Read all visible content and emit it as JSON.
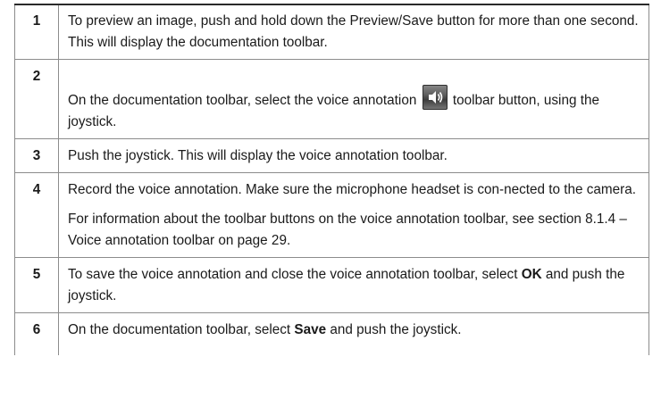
{
  "steps": [
    {
      "number": "1",
      "text": "To preview an image, push and hold down the Preview/Save button for more than one second. This will display the documentation toolbar."
    },
    {
      "number": "2",
      "text_before": "On the documentation toolbar, select the voice annotation ",
      "icon": "voice-annotation-speaker-icon",
      "text_after": " toolbar button, using the joystick."
    },
    {
      "number": "3",
      "text": "Push the joystick. This will display the voice annotation toolbar."
    },
    {
      "number": "4",
      "text": "Record the voice annotation. Make sure the microphone headset is con-nected to the camera.",
      "text2": "For information about the toolbar buttons on the voice annotation toolbar, see section 8.1.4 – Voice annotation toolbar on page 29."
    },
    {
      "number": "5",
      "text_before": "To save the voice annotation and close the voice annotation toolbar, select ",
      "bold": "OK",
      "text_after": " and push the joystick."
    },
    {
      "number": "6",
      "text_before": "On the documentation toolbar, select ",
      "bold": "Save",
      "text_after": " and push the joystick."
    }
  ]
}
